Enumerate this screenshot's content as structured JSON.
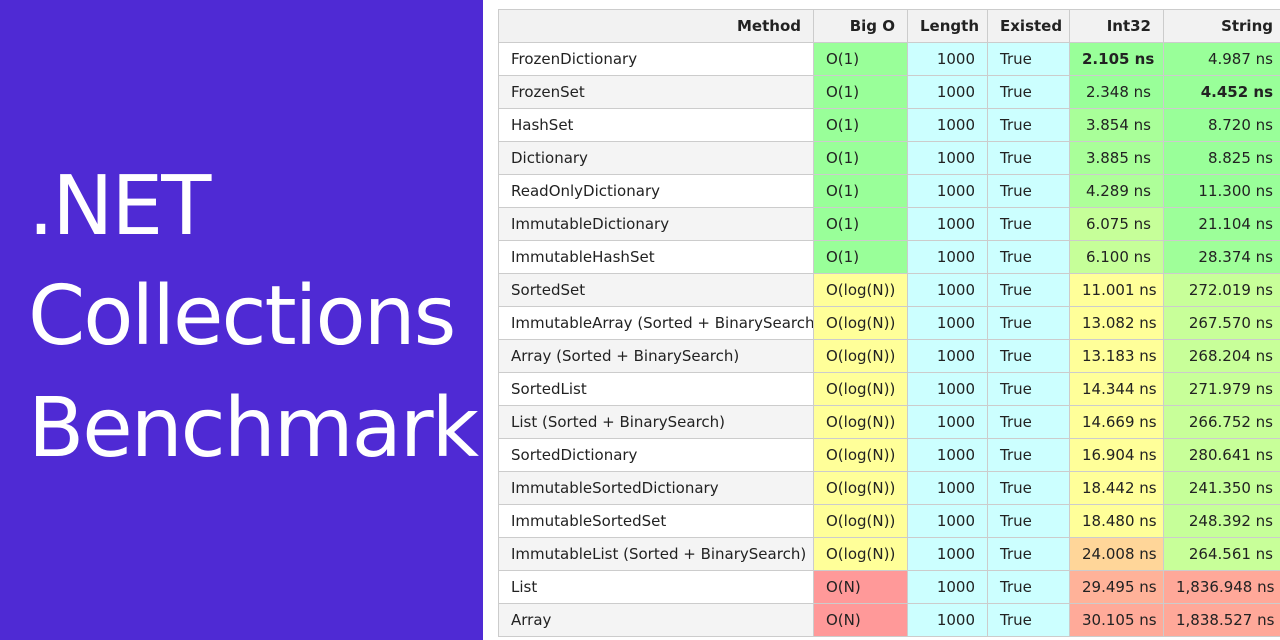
{
  "title": {
    "line1": ".NET",
    "line2": "Collections",
    "line3": "Benchmark"
  },
  "colors": {
    "panel": "#4f2ad4",
    "o1": "#99ff99",
    "ologn": "#ffff99",
    "on": "#ff9999",
    "cyan": "#ccffff"
  },
  "table": {
    "headers": [
      "Method",
      "Big O",
      "Length",
      "Existed",
      "Int32",
      "String"
    ],
    "rows": [
      {
        "method": "FrozenDictionary",
        "bigo": "O(1)",
        "length": "1000",
        "existed": "True",
        "int32": "2.105 ns",
        "string": "4.987 ns",
        "int32_color": "#99ff99",
        "string_color": "#99ff99",
        "int32_bold": true,
        "string_bold": false
      },
      {
        "method": "FrozenSet",
        "bigo": "O(1)",
        "length": "1000",
        "existed": "True",
        "int32": "2.348 ns",
        "string": "4.452 ns",
        "int32_color": "#99ff99",
        "string_color": "#99ff99",
        "int32_bold": false,
        "string_bold": true
      },
      {
        "method": "HashSet",
        "bigo": "O(1)",
        "length": "1000",
        "existed": "True",
        "int32": "3.854 ns",
        "string": "8.720 ns",
        "int32_color": "#a9ff99",
        "string_color": "#99ff99",
        "int32_bold": false,
        "string_bold": false
      },
      {
        "method": "Dictionary",
        "bigo": "O(1)",
        "length": "1000",
        "existed": "True",
        "int32": "3.885 ns",
        "string": "8.825 ns",
        "int32_color": "#a9ff99",
        "string_color": "#99ff99",
        "int32_bold": false,
        "string_bold": false
      },
      {
        "method": "ReadOnlyDictionary",
        "bigo": "O(1)",
        "length": "1000",
        "existed": "True",
        "int32": "4.289 ns",
        "string": "11.300 ns",
        "int32_color": "#aeff99",
        "string_color": "#99ff99",
        "int32_bold": false,
        "string_bold": false
      },
      {
        "method": "ImmutableDictionary",
        "bigo": "O(1)",
        "length": "1000",
        "existed": "True",
        "int32": "6.075 ns",
        "string": "21.104 ns",
        "int32_color": "#c6ff99",
        "string_color": "#9cff99",
        "int32_bold": false,
        "string_bold": false
      },
      {
        "method": "ImmutableHashSet",
        "bigo": "O(1)",
        "length": "1000",
        "existed": "True",
        "int32": "6.100 ns",
        "string": "28.374 ns",
        "int32_color": "#c6ff99",
        "string_color": "#9fff99",
        "int32_bold": false,
        "string_bold": false
      },
      {
        "method": "SortedSet",
        "bigo": "O(log(N))",
        "length": "1000",
        "existed": "True",
        "int32": "11.001 ns",
        "string": "272.019 ns",
        "int32_color": "#ffff99",
        "string_color": "#c8ff99",
        "int32_bold": false,
        "string_bold": false
      },
      {
        "method": "ImmutableArray (Sorted + BinarySearch)",
        "bigo": "O(log(N))",
        "length": "1000",
        "existed": "True",
        "int32": "13.082 ns",
        "string": "267.570 ns",
        "int32_color": "#ffff99",
        "string_color": "#c8ff99",
        "int32_bold": false,
        "string_bold": false
      },
      {
        "method": "Array (Sorted + BinarySearch)",
        "bigo": "O(log(N))",
        "length": "1000",
        "existed": "True",
        "int32": "13.183 ns",
        "string": "268.204 ns",
        "int32_color": "#ffff99",
        "string_color": "#c8ff99",
        "int32_bold": false,
        "string_bold": false
      },
      {
        "method": "SortedList",
        "bigo": "O(log(N))",
        "length": "1000",
        "existed": "True",
        "int32": "14.344 ns",
        "string": "271.979 ns",
        "int32_color": "#ffff99",
        "string_color": "#c8ff99",
        "int32_bold": false,
        "string_bold": false
      },
      {
        "method": "List (Sorted + BinarySearch)",
        "bigo": "O(log(N))",
        "length": "1000",
        "existed": "True",
        "int32": "14.669 ns",
        "string": "266.752 ns",
        "int32_color": "#ffff99",
        "string_color": "#c8ff99",
        "int32_bold": false,
        "string_bold": false
      },
      {
        "method": "SortedDictionary",
        "bigo": "O(log(N))",
        "length": "1000",
        "existed": "True",
        "int32": "16.904 ns",
        "string": "280.641 ns",
        "int32_color": "#ffff99",
        "string_color": "#c8ff99",
        "int32_bold": false,
        "string_bold": false
      },
      {
        "method": "ImmutableSortedDictionary",
        "bigo": "O(log(N))",
        "length": "1000",
        "existed": "True",
        "int32": "18.442 ns",
        "string": "241.350 ns",
        "int32_color": "#ffff99",
        "string_color": "#c6ff99",
        "int32_bold": false,
        "string_bold": false
      },
      {
        "method": "ImmutableSortedSet",
        "bigo": "O(log(N))",
        "length": "1000",
        "existed": "True",
        "int32": "18.480 ns",
        "string": "248.392 ns",
        "int32_color": "#ffff99",
        "string_color": "#c6ff99",
        "int32_bold": false,
        "string_bold": false
      },
      {
        "method": "ImmutableList (Sorted + BinarySearch)",
        "bigo": "O(log(N))",
        "length": "1000",
        "existed": "True",
        "int32": "24.008 ns",
        "string": "264.561 ns",
        "int32_color": "#ffd699",
        "string_color": "#c8ff99",
        "int32_bold": false,
        "string_bold": false
      },
      {
        "method": "List",
        "bigo": "O(N)",
        "length": "1000",
        "existed": "True",
        "int32": "29.495 ns",
        "string": "1,836.948 ns",
        "int32_color": "#ffb299",
        "string_color": "#ffa899",
        "int32_bold": false,
        "string_bold": false
      },
      {
        "method": "Array",
        "bigo": "O(N)",
        "length": "1000",
        "existed": "True",
        "int32": "30.105 ns",
        "string": "1,838.527 ns",
        "int32_color": "#ffaa99",
        "string_color": "#ffa899",
        "int32_bold": false,
        "string_bold": false
      }
    ]
  }
}
